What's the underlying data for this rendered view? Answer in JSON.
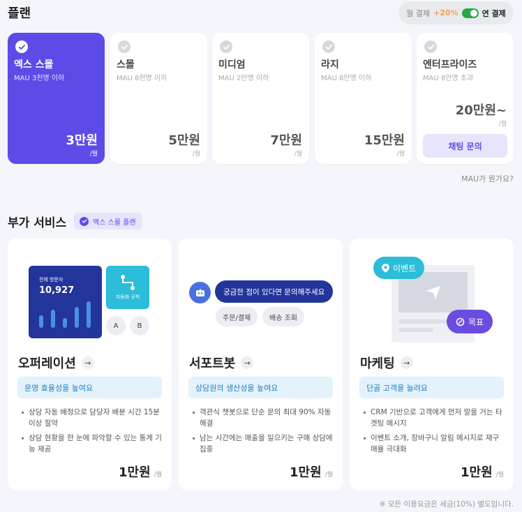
{
  "plans_section": {
    "title": "플랜",
    "billing": {
      "monthly": "월 결제",
      "discount": "+20%",
      "yearly": "연 결제",
      "yearly_selected": true
    }
  },
  "plans": [
    {
      "name": "엑스 스몰",
      "mau": "MAU 3천명 이하",
      "price": "3만원",
      "unit": "/월",
      "selected": true
    },
    {
      "name": "스몰",
      "mau": "MAU 8천명 이하",
      "price": "5만원",
      "unit": "/월",
      "selected": false
    },
    {
      "name": "미디엄",
      "mau": "MAU 2만명 이하",
      "price": "7만원",
      "unit": "/월",
      "selected": false
    },
    {
      "name": "라지",
      "mau": "MAU 8만명 이하",
      "price": "15만원",
      "unit": "/월",
      "selected": false
    },
    {
      "name": "엔터프라이즈",
      "mau": "MAU 8만명 초과",
      "price": "20만원~",
      "unit": "/월",
      "cta": "채팅 문의",
      "selected": false
    }
  ],
  "mau_help": "MAU가 뭔가요?",
  "addons": {
    "title": "부가 서비스",
    "plan_badge": "엑스 스몰 플랜"
  },
  "services": [
    {
      "title": "오퍼레이션",
      "tag": "운영 효율성을 높여요",
      "bullets": [
        "상담 자동 배정으로 담당자 배분 시간 15분 이상 절약",
        "상담 현황을 한 눈에 파악할 수 있는 통계 기능 제공"
      ],
      "price": "1만원",
      "unit": "/월",
      "illus": {
        "visitor_label": "전체 방문자",
        "visitor_count": "10,927",
        "rule_label": "자동화 규칙",
        "a": "A",
        "b": "B",
        "bars": [
          18,
          26,
          14,
          30,
          38
        ]
      }
    },
    {
      "title": "서포트봇",
      "tag": "상담원의 생산성을 높여요",
      "bullets": [
        "객관식 챗봇으로 단순 문의 최대 90% 자동 해결",
        "남는 시간에는 매출을 일으키는 구매 상담에 집중"
      ],
      "price": "1만원",
      "unit": "/월",
      "illus": {
        "bubble": "궁금한 점이 있다면 문의해주세요",
        "chip1": "주문/결제",
        "chip2": "배송 조회"
      }
    },
    {
      "title": "마케팅",
      "tag": "단골 고객을 늘려요",
      "bullets": [
        "CRM 기반으로 고객에게 먼저 말을 거는 타겟팅 메시지",
        "이벤트 소개, 장바구니 알림 메시지로 재구매율 극대화"
      ],
      "price": "1만원",
      "unit": "/월",
      "illus": {
        "event": "이벤트",
        "goal": "목표"
      }
    }
  ],
  "footnote": "※ 모든 이용요금은 세금(10%) 별도입니다.",
  "colors": {
    "accent": "#5d4be8",
    "navy": "#23349a",
    "cyan": "#2bbdd9",
    "toggle_on": "#28a745"
  }
}
